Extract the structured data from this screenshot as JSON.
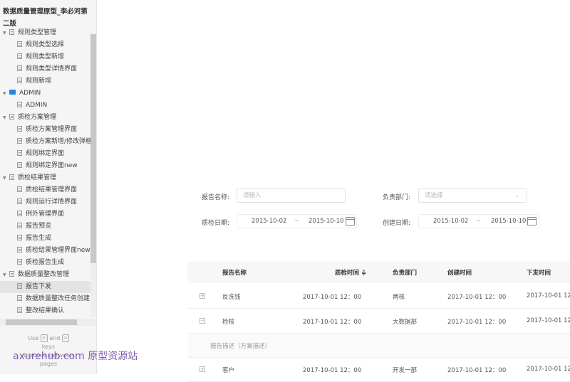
{
  "sidebar": {
    "project_title": "数据质量管理原型_李必河第二版",
    "items": [
      {
        "label": "规则类型管理",
        "level": 0,
        "type": "page",
        "expanded": true
      },
      {
        "label": "规则类型选择",
        "level": 1,
        "type": "page"
      },
      {
        "label": "规则类型新增",
        "level": 1,
        "type": "page"
      },
      {
        "label": "规则类型详情界面",
        "level": 1,
        "type": "page"
      },
      {
        "label": "规则新增",
        "level": 1,
        "type": "page"
      },
      {
        "label": "ADMIN",
        "level": 0,
        "type": "folder",
        "expanded": true
      },
      {
        "label": "ADMIN",
        "level": 1,
        "type": "page"
      },
      {
        "label": "质检方案管理",
        "level": 0,
        "type": "page",
        "expanded": true
      },
      {
        "label": "质检方案管理界面",
        "level": 1,
        "type": "page"
      },
      {
        "label": "质检方案新增/修改弹框",
        "level": 1,
        "type": "page"
      },
      {
        "label": "规则绑定界面",
        "level": 1,
        "type": "page"
      },
      {
        "label": "规则绑定界面new",
        "level": 1,
        "type": "page"
      },
      {
        "label": "质检结果管理",
        "level": 0,
        "type": "page",
        "expanded": true
      },
      {
        "label": "质检结果管理界面",
        "level": 1,
        "type": "page"
      },
      {
        "label": "规则运行详情界面",
        "level": 1,
        "type": "page"
      },
      {
        "label": "例外管理界面",
        "level": 1,
        "type": "page"
      },
      {
        "label": "报告预览",
        "level": 1,
        "type": "page"
      },
      {
        "label": "报告生成",
        "level": 1,
        "type": "page"
      },
      {
        "label": "质检结果管理界面new",
        "level": 1,
        "type": "page"
      },
      {
        "label": "质检报告生成",
        "level": 1,
        "type": "page"
      },
      {
        "label": "数据质量整改管理",
        "level": 0,
        "type": "page",
        "expanded": true
      },
      {
        "label": "报告下发",
        "level": 1,
        "type": "page",
        "selected": true
      },
      {
        "label": "数据质量整改任务创建",
        "level": 1,
        "type": "page"
      },
      {
        "label": "整改结果确认",
        "level": 1,
        "type": "page"
      }
    ],
    "hint": {
      "use": "Use",
      "key_prev": "<",
      "and": "and",
      "key_next": ">",
      "keys": "keys",
      "rest": "to move between",
      "pages": "pages"
    },
    "watermark": "axurehub.com 原型资源站"
  },
  "form": {
    "report_name_label": "报告名称:",
    "report_name_placeholder": "请输入",
    "dept_label": "负责部门:",
    "dept_placeholder": "请选择",
    "qc_date_label": "质检日期:",
    "qc_date_start": "2015-10-02",
    "qc_date_sep": "~",
    "qc_date_end": "2015-10-10",
    "create_date_label": "创建日期:",
    "create_date_start": "2015-10-02",
    "create_date_sep": "~",
    "create_date_end": "2015-10-10"
  },
  "table": {
    "headers": [
      "报告名称",
      "质检时间 ≑",
      "负责部门",
      "创建时间",
      "下发时间"
    ],
    "rows": [
      {
        "expand": "+",
        "name": "反洗钱",
        "qc_time": "2017-10-01 12：00",
        "dept": "两核",
        "created": "2017-10-01 12：00",
        "issued": "2017-10-01 12"
      },
      {
        "expand": "−",
        "name": "检核",
        "qc_time": "2017-10-01 12：00",
        "dept": "大数据部",
        "created": "2017-10-01 12：00",
        "issued": "2017-10-01 12"
      },
      {
        "expand": "+",
        "name": "客户",
        "qc_time": "2017-10-01 12：00",
        "dept": "开发一部",
        "created": "2017-10-01 12：00",
        "issued": "2017-10-01 12"
      }
    ],
    "expanded_desc": "报告描述（方案描述）"
  },
  "colors": {
    "folder": "#1e88e5",
    "watermark": "#6a3fa0",
    "header_bg": "#f7f7f7"
  }
}
